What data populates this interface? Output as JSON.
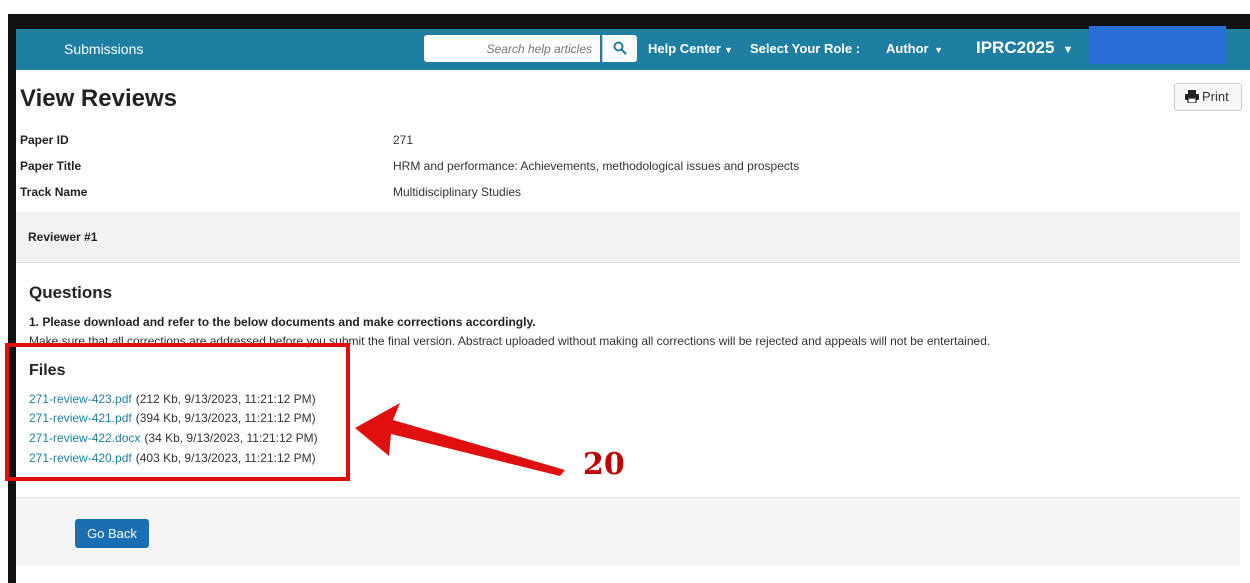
{
  "navbar": {
    "brand": "Submissions",
    "search_placeholder": "Search help articles",
    "help_center": "Help Center",
    "role_label": "Select Your Role :",
    "role_value": "Author",
    "conference": "IPRC2025"
  },
  "page": {
    "title": "View Reviews",
    "print_label": "Print"
  },
  "paper": {
    "id_label": "Paper ID",
    "id_value": "271",
    "title_label": "Paper Title",
    "title_value": "HRM and performance: Achievements, methodological issues and prospects",
    "track_label": "Track Name",
    "track_value": "Multidisciplinary Studies"
  },
  "reviewer": {
    "heading": "Reviewer #1"
  },
  "questions": {
    "title": "Questions",
    "q1": "1. Please download and refer to the below documents and make corrections accordingly.",
    "q1_note": "Make sure that all corrections are addressed before you submit the final version. Abstract uploaded without making all corrections will be rejected and appeals will not be entertained."
  },
  "files": {
    "title": "Files",
    "items": [
      {
        "name": "271-review-423.pdf",
        "meta": "(212 Kb, 9/13/2023, 11:21:12 PM)"
      },
      {
        "name": "271-review-421.pdf",
        "meta": "(394 Kb, 9/13/2023, 11:21:12 PM)"
      },
      {
        "name": "271-review-422.docx",
        "meta": "(34 Kb, 9/13/2023, 11:21:12 PM)"
      },
      {
        "name": "271-review-420.pdf",
        "meta": "(403 Kb, 9/13/2023, 11:21:12 PM)"
      }
    ]
  },
  "annotation": {
    "number": "20",
    "color": "#e01010"
  },
  "footer": {
    "go_back": "Go Back"
  },
  "colors": {
    "navbar": "#1f7fa3",
    "link": "#1f7fa3",
    "primary_button": "#1a6fb3"
  }
}
